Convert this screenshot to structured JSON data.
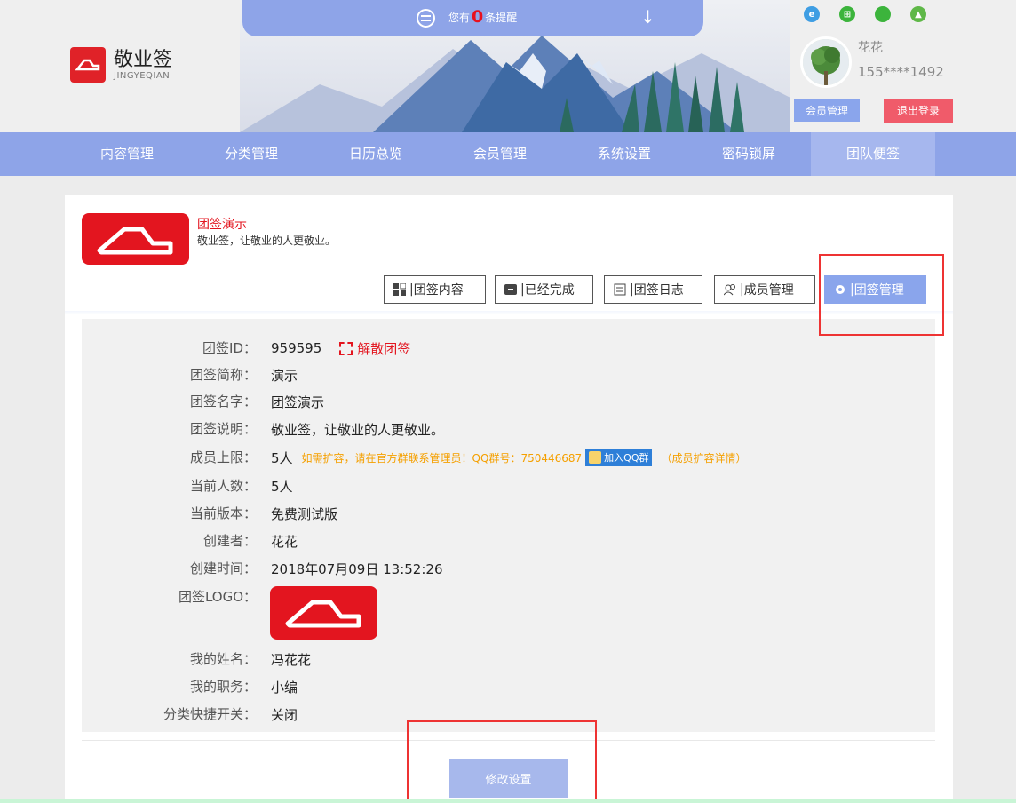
{
  "header": {
    "app_name": "敬业签",
    "app_sub": "JINGYEQIAN",
    "notice_prefix": "您有",
    "notice_count": "0",
    "notice_suffix": "条提醒",
    "user_name": "花花",
    "user_phone": "155****1492",
    "member_btn": "会员管理",
    "logout_btn": "退出登录",
    "platform_icons": [
      "ie-icon",
      "windows-icon",
      "apple-icon",
      "android-icon"
    ]
  },
  "nav": {
    "items": [
      "内容管理",
      "分类管理",
      "日历总览",
      "会员管理",
      "系统设置",
      "密码锁屏",
      "团队便签"
    ],
    "active": "团队便签"
  },
  "team": {
    "title": "团签演示",
    "desc": "敬业签，让敬业的人更敬业。"
  },
  "tabs": [
    "团签内容",
    "已经完成",
    "团签日志",
    "成员管理",
    "团签管理"
  ],
  "info": {
    "id_label": "团签ID：",
    "id_value": "959595",
    "dissolve": "解散团签",
    "short_label": "团签简称：",
    "short_value": "演示",
    "name_label": "团签名字：",
    "name_value": "团签演示",
    "desc_label": "团签说明：",
    "desc_value": "敬业签，让敬业的人更敬业。",
    "limit_label": "成员上限：",
    "limit_value": "5人",
    "limit_note": "如需扩容，请在官方群联系管理员！QQ群号：750446687",
    "qq_btn": "加入QQ群",
    "expand_link": "（成员扩容详情）",
    "count_label": "当前人数：",
    "count_value": "5人",
    "version_label": "当前版本：",
    "version_value": "免费测试版",
    "creator_label": "创建者：",
    "creator_value": "花花",
    "time_label": "创建时间：",
    "time_value": "2018年07月09日 13:52:26",
    "logo_label": "团签LOGO：",
    "myname_label": "我的姓名：",
    "myname_value": "冯花花",
    "job_label": "我的职务：",
    "job_value": "小编",
    "switch_label": "分类快捷开关：",
    "switch_value": "关闭"
  },
  "actions": {
    "modify": "修改设置"
  },
  "colors": {
    "accent": "#8ea4e8",
    "brand_red": "#e3151f",
    "logout": "#f05b6a",
    "warn": "#f5a000"
  }
}
